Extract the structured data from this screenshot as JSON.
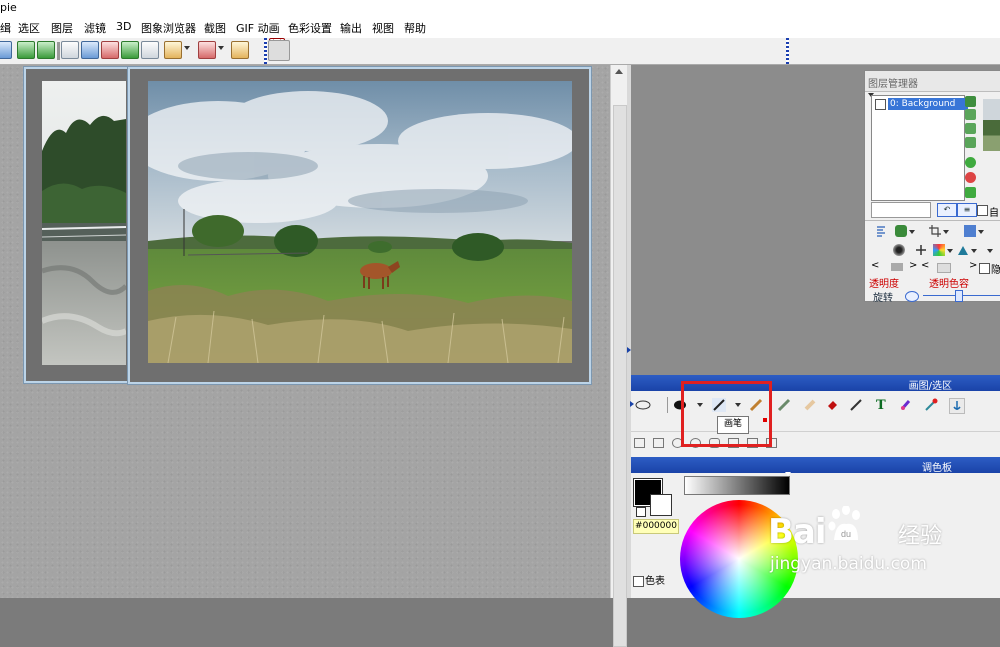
{
  "app": {
    "title_fragment": "pie"
  },
  "menu": [
    "缉",
    "选区",
    "图层",
    "滤镜",
    "3D",
    "图象浏览器",
    "截图",
    "GIF 动画",
    "色彩设置",
    "输出",
    "视图",
    "帮助"
  ],
  "layer_manager": {
    "title": "图层管理器",
    "layer_name": "0: Background",
    "auto_label": "自",
    "hide_label": "隐",
    "transparency_label": "透明度",
    "transparent_color_label": "透明色容",
    "rotate_label": "旋转"
  },
  "drawing_panel": {
    "title": "画图/选区",
    "tooltip": "画笔"
  },
  "palette": {
    "title": "调色板",
    "hex": "#000000",
    "color_table_label": "色表"
  },
  "colors": {
    "panel_header": "#1f4ab0",
    "highlight": "#e02020",
    "foreground": "#000000",
    "background": "#ffffff"
  },
  "watermark": {
    "brand_en": "Bai",
    "brand_du": "du",
    "brand_cn": "经验",
    "url": "jingyan.baidu.com"
  }
}
